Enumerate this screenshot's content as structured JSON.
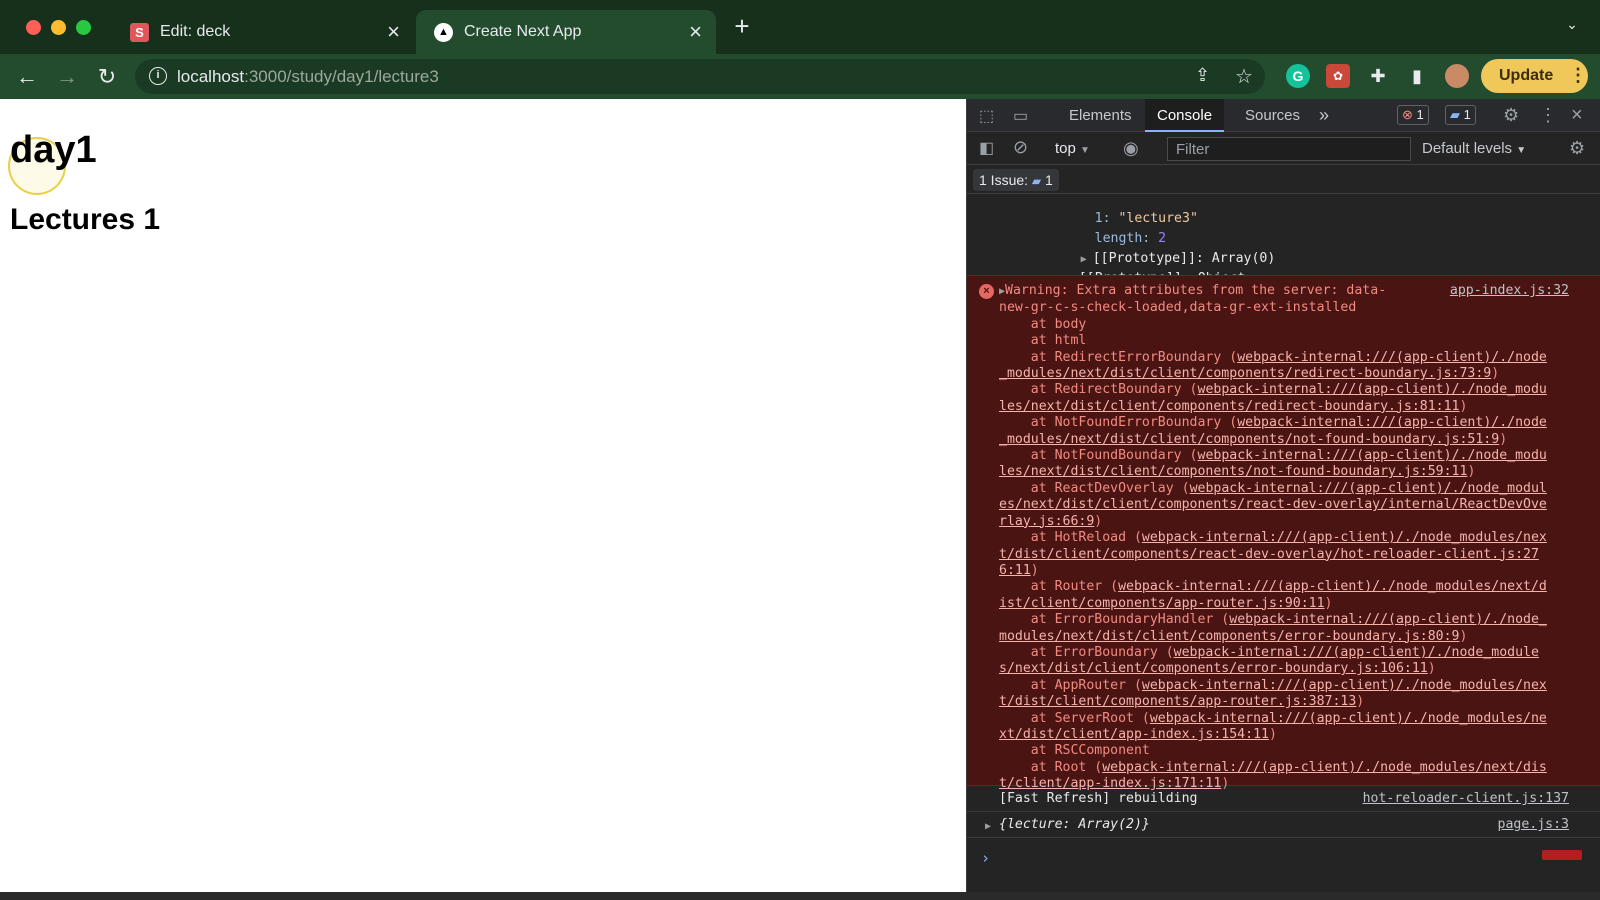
{
  "window": {
    "traffic_lights": {
      "close": "#fe5f57",
      "minimize": "#febc2e",
      "zoom": "#28c840"
    }
  },
  "tabs": [
    {
      "title": "Edit: deck",
      "favicon_letter": "S",
      "favicon_color": "#e0575b",
      "active": false
    },
    {
      "title": "Create Next App",
      "favicon_letter": "▲",
      "favicon_color": "#ffffff",
      "active": true
    }
  ],
  "toolbar": {
    "url_host": "localhost",
    "url_rest": ":3000/study/day1/lecture3",
    "update_label": "Update",
    "icons": [
      "back-icon",
      "forward-icon",
      "reload-icon",
      "info-icon",
      "share-icon",
      "star-icon",
      "grammarly-icon",
      "extension-icon",
      "puzzle-icon",
      "sidepanel-icon",
      "profile-icon",
      "menu-icon"
    ]
  },
  "page": {
    "heading": "day1",
    "subheading": "Lectures 1"
  },
  "devtools": {
    "tabs": {
      "elements": "Elements",
      "console": "Console",
      "sources": "Sources",
      "more": "»"
    },
    "error_count": "1",
    "message_count": "1",
    "context": "top",
    "filter_placeholder": "Filter",
    "levels": "Default levels",
    "issues_label": "1 Issue:",
    "issues_count": "1",
    "object_lines": {
      "index1_key": "1:",
      "index1_val": "\"lecture3\"",
      "length_key": "length:",
      "length_val": "2",
      "proto1": "[[Prototype]]: Array(0)",
      "proto2": "[[Prototype]]: Object"
    },
    "warning": {
      "message_line1": "Warning: Extra attributes from the server: data-",
      "message_line2": "new-gr-c-s-check-loaded,data-gr-ext-installed",
      "source": "app-index.js:32",
      "stack": [
        {
          "at": "    at body",
          "link": ""
        },
        {
          "at": "    at html",
          "link": ""
        },
        {
          "at": "    at RedirectErrorBoundary (",
          "link": "webpack-internal:///(app-client)/./node",
          "cont": "_modules/next/dist/client/components/redirect-boundary.js:73:9",
          "tail": ")"
        },
        {
          "at": "    at RedirectBoundary (",
          "link": "webpack-internal:///(app-client)/./node_modu",
          "cont": "les/next/dist/client/components/redirect-boundary.js:81:11",
          "tail": ")"
        },
        {
          "at": "    at NotFoundErrorBoundary (",
          "link": "webpack-internal:///(app-client)/./node",
          "cont": "_modules/next/dist/client/components/not-found-boundary.js:51:9",
          "tail": ")"
        },
        {
          "at": "    at NotFoundBoundary (",
          "link": "webpack-internal:///(app-client)/./node_modu",
          "cont": "les/next/dist/client/components/not-found-boundary.js:59:11",
          "tail": ")"
        },
        {
          "at": "    at ReactDevOverlay (",
          "link": "webpack-internal:///(app-client)/./node_modul",
          "cont": "es/next/dist/client/components/react-dev-overlay/internal/ReactDevOve",
          "cont2": "rlay.js:66:9",
          "tail": ")"
        },
        {
          "at": "    at HotReload (",
          "link": "webpack-internal:///(app-client)/./node_modules/nex",
          "cont": "t/dist/client/components/react-dev-overlay/hot-reloader-client.js:27",
          "cont2": "6:11",
          "tail": ")"
        },
        {
          "at": "    at Router (",
          "link": "webpack-internal:///(app-client)/./node_modules/next/d",
          "cont": "ist/client/components/app-router.js:90:11",
          "tail": ")"
        },
        {
          "at": "    at ErrorBoundaryHandler (",
          "link": "webpack-internal:///(app-client)/./node_",
          "cont": "modules/next/dist/client/components/error-boundary.js:80:9",
          "tail": ")"
        },
        {
          "at": "    at ErrorBoundary (",
          "link": "webpack-internal:///(app-client)/./node_module",
          "cont": "s/next/dist/client/components/error-boundary.js:106:11",
          "tail": ")"
        },
        {
          "at": "    at AppRouter (",
          "link": "webpack-internal:///(app-client)/./node_modules/nex",
          "cont": "t/dist/client/components/app-router.js:387:13",
          "tail": ")"
        },
        {
          "at": "    at ServerRoot (",
          "link": "webpack-internal:///(app-client)/./node_modules/ne",
          "cont": "xt/dist/client/app-index.js:154:11",
          "tail": ")"
        },
        {
          "at": "    at RSCComponent",
          "link": ""
        },
        {
          "at": "    at Root (",
          "link": "webpack-internal:///(app-client)/./node_modules/next/dis",
          "cont": "t/client/app-index.js:171:11",
          "tail": ")"
        }
      ]
    },
    "logs": [
      {
        "text": "[Fast Refresh] rebuilding",
        "source": "hot-reloader-client.js:137"
      },
      {
        "text": "{lecture: Array(2)}",
        "source": "page.js:3"
      }
    ],
    "prompt": "›"
  }
}
